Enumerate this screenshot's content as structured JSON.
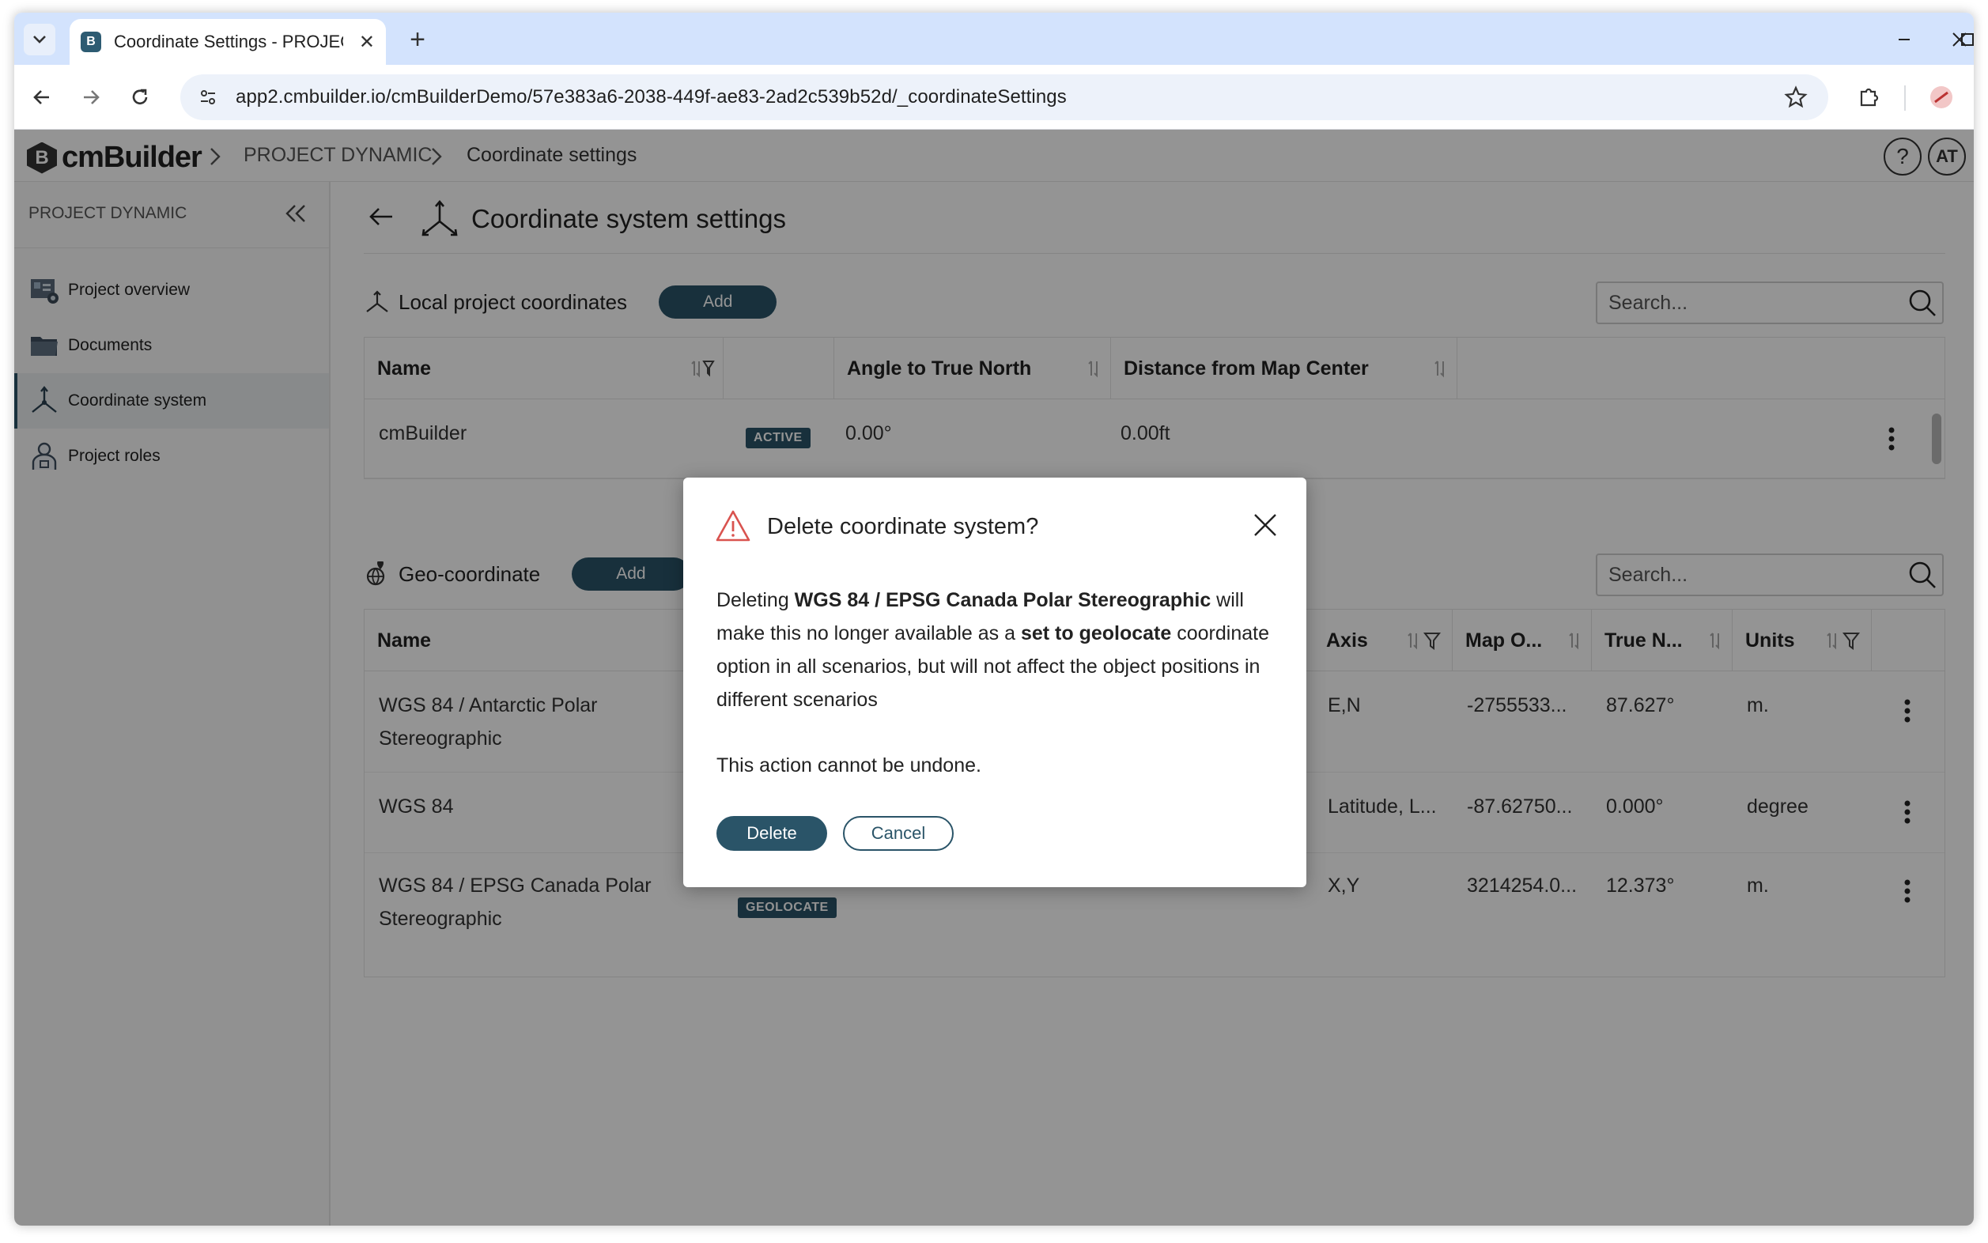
{
  "browser": {
    "tab_title": "Coordinate Settings - PROJECT",
    "url": "app2.cmbuilder.io/cmBuilderDemo/57e383a6-2038-449f-ae83-2ad2c539b52d/_coordinateSettings",
    "favicon_letter": "B"
  },
  "header": {
    "logo_letter": "B",
    "logo_text": "cmBuilder",
    "breadcrumb": [
      "PROJECT DYNAMIC",
      "Coordinate settings"
    ],
    "help_label": "?",
    "avatar_initials": "AT"
  },
  "sidebar": {
    "title": "PROJECT DYNAMIC",
    "items": [
      {
        "label": "Project overview",
        "icon": "project-overview-icon",
        "active": false
      },
      {
        "label": "Documents",
        "icon": "folder-icon",
        "active": false
      },
      {
        "label": "Coordinate system",
        "icon": "coordinate-axes-icon",
        "active": true
      },
      {
        "label": "Project roles",
        "icon": "person-badge-icon",
        "active": false
      }
    ]
  },
  "main": {
    "title": "Coordinate system settings",
    "local": {
      "label": "Local project coordinates",
      "add_label": "Add",
      "search_placeholder": "Search...",
      "columns": [
        "Name",
        "Angle to True North",
        "Distance from Map Center"
      ],
      "rows": [
        {
          "name": "cmBuilder",
          "badge": "ACTIVE",
          "angle": "0.00°",
          "distance": "0.00ft"
        }
      ]
    },
    "geo": {
      "label": "Geo-coordinate",
      "add_label": "Add",
      "search_placeholder": "Search...",
      "columns": [
        "Name",
        "Axis",
        "Map O...",
        "True N...",
        "Units"
      ],
      "rows": [
        {
          "name_line1": "WGS 84 / Antarctic Polar",
          "name_line2": "Stereographic",
          "badge": "",
          "axis": "E,N",
          "map_origin": "-2755533...",
          "true_north": "87.627°",
          "units": "m."
        },
        {
          "name_line1": "WGS 84",
          "name_line2": "",
          "badge": "",
          "axis": "Latitude, L...",
          "map_origin": "-87.62750...",
          "true_north": "0.000°",
          "units": "degree"
        },
        {
          "name_line1": "WGS 84 / EPSG Canada Polar",
          "name_line2": "Stereographic",
          "badge": "GEOLOCATE",
          "axis": "X,Y",
          "map_origin": "3214254.0...",
          "true_north": "12.373°",
          "units": "m."
        }
      ]
    }
  },
  "dialog": {
    "title": "Delete coordinate system?",
    "body_prefix": "Deleting ",
    "body_name": "WGS 84 / EPSG Canada Polar Stereographic",
    "body_mid": " will make this no longer available as a ",
    "body_bold2": "set to geolocate",
    "body_suffix": " coordinate option in all scenarios, but will not affect the object positions in different scenarios",
    "note": "This action cannot be undone.",
    "delete_label": "Delete",
    "cancel_label": "Cancel"
  },
  "colors": {
    "accent": "#2a5468",
    "tabstrip": "#d3e3fd",
    "warning": "#d9534f"
  }
}
